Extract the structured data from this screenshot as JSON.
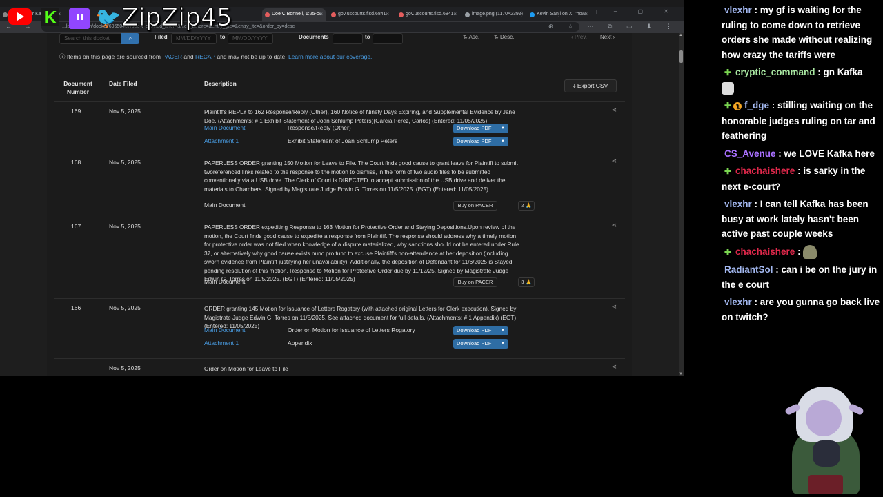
{
  "overlay": {
    "handle": "ZipZip45"
  },
  "browser": {
    "tabs": [
      {
        "label": "...'s Lawyer Kar",
        "active": false,
        "color": "#888888"
      },
      {
        "label": "Doe v. Bonnell, 1:25-cv",
        "active": true,
        "color": "#e35d5d"
      },
      {
        "label": "gov.uscourts.flsd.6841",
        "active": false,
        "color": "#e35d5d"
      },
      {
        "label": "gov.uscourts.flsd.6841",
        "active": false,
        "color": "#e35d5d"
      },
      {
        "label": "image.png (1170×2397)",
        "active": false,
        "color": "#9aa0a6"
      },
      {
        "label": "Kevin Sanji on X: \"how",
        "active": false,
        "color": "#1d9bf0"
      }
    ],
    "url": "...listener.com/docket/69650487/doe-v-b.../filed_after=&filed_before=&entry_gte=&entry_lte=&order_by=desc"
  },
  "filters": {
    "search_placeholder": "Search this docket",
    "filed_label": "Filed",
    "date_placeholder": "MM/DD/YYYY",
    "to_label": "to",
    "documents_label": "Documents",
    "asc": "Asc.",
    "desc": "Desc.",
    "prev": "Prev.",
    "next": "Next"
  },
  "notice": {
    "prefix": "Items on this page are sourced from",
    "pacer": "PACER",
    "and": "and",
    "recap": "RECAP",
    "suffix": "and may not be up to date.",
    "learn": "Learn more about our coverage."
  },
  "table": {
    "headers": {
      "doc_number": "Document Number",
      "date_filed": "Date Filed",
      "description": "Description"
    },
    "export": "Export CSV",
    "rows": [
      {
        "num": "169",
        "date": "Nov 5, 2025",
        "desc": "Plaintiff's REPLY to 162 Response/Reply (Other), 160 Notice of Ninety Days Expiring, and Supplemental Evidence by Jane Doe. (Attachments: # 1 Exhibit Statement of Joan Schlump Peters)(Garcia Perez, Carlos) (Entered: 11/05/2025)",
        "subs": [
          {
            "name": "Main Document",
            "desc": "Response/Reply (Other)",
            "action": "Download PDF"
          },
          {
            "name": "Attachment 1",
            "desc": "Exhibit Statement of Joan Schlump Peters",
            "action": "Download PDF"
          }
        ]
      },
      {
        "num": "168",
        "date": "Nov 5, 2025",
        "desc": "PAPERLESS ORDER granting 150 Motion for Leave to File. The Court finds good cause to grant leave for Plaintiff to submit tworeferenced links related to the response to the motion to dismiss, in the form of two audio files to be submitted conventionally via a USB drive. The Clerk of Court is DIRECTED to accept submission of the USB drive and deliver the materials to Chambers. Signed by Magistrate Judge Edwin G. Torres on 11/5/2025. (EGT) (Entered: 11/05/2025)",
        "subs": [
          {
            "name": "Main Document",
            "desc": "",
            "action": "Buy on PACER",
            "pray": "2 🙏"
          }
        ]
      },
      {
        "num": "167",
        "date": "Nov 5, 2025",
        "desc": "PAPERLESS ORDER expediting Response to 163 Motion for Protective Order and Staying Depositions.Upon review of the motion, the Court finds good cause to expedite a response from Plaintiff. The response should address why a timely motion for protective order was not filed when knowledge of a dispute materialized, why sanctions should not be entered under Rule 37, or alternatively why good cause exists nunc pro tunc to excuse Plaintiff's non-attendance at her deposition (including sworn evidence from Plaintiff justifying her unavailability). Additionally, the deposition of Defendant for 11/6/2025 is Stayed pending resolution of this motion. Response to Motion for Protective Order due by 11/12/25. Signed by Magistrate Judge Edwin G. Torres on 11/5/2025. (EGT) (Entered: 11/05/2025)",
        "subs": [
          {
            "name": "Main Document",
            "desc": "",
            "action": "Buy on PACER",
            "pray": "3 🙏"
          }
        ]
      },
      {
        "num": "166",
        "date": "Nov 5, 2025",
        "desc": "ORDER granting 145 Motion for Issuance of Letters Rogatory (with attached original Letters for Clerk execution). Signed by Magistrate Judge Edwin G. Torres on 11/5/2025. See attached document for full details. (Attachments: # 1 Appendix) (EGT) (Entered: 11/05/2025)",
        "subs": [
          {
            "name": "Main Document",
            "desc": "Order on Motion for Issuance of Letters Rogatory",
            "action": "Download PDF"
          },
          {
            "name": "Attachment 1",
            "desc": "Appendix",
            "action": "Download PDF"
          }
        ]
      },
      {
        "num": "",
        "date": "Nov 5, 2025",
        "desc": "Order on Motion for Leave to File",
        "subs": []
      }
    ]
  },
  "chat": [
    {
      "user": "vlexhr",
      "color": "#a3b8f0",
      "text": "my gf is waiting for the ruling to come down to retrieve orders she made without realizing how crazy the tariffs were",
      "badges": []
    },
    {
      "user": "cryptic_command",
      "color": "#a8e6a1",
      "text": "gn Kafka",
      "badges": [
        "sub"
      ],
      "emote": true
    },
    {
      "user": "f_dge",
      "color": "#a3b8f0",
      "text": "stilling waiting on the honorable judges ruling on tar and feathering",
      "badges": [
        "sub",
        "bits"
      ]
    },
    {
      "user": "CS_Avenue",
      "color": "#a970ff",
      "text": "we LOVE Kafka here",
      "badges": []
    },
    {
      "user": "chachaishere",
      "color": "#e0284b",
      "text": "is sarky in the next e-court?",
      "badges": [
        "sub"
      ]
    },
    {
      "user": "vlexhr",
      "color": "#a3b8f0",
      "text": "I can tell Kafka has been busy at work lately hasn't been active past couple weeks",
      "badges": []
    },
    {
      "user": "chachaishere",
      "color": "#e0284b",
      "text": "",
      "badges": [
        "sub"
      ],
      "emote2": true
    },
    {
      "user": "RadiantSol",
      "color": "#a3b8f0",
      "text": "can i be on the jury in the e court",
      "badges": []
    },
    {
      "user": "vlexhr",
      "color": "#a3b8f0",
      "text": "are you gunna go back live on twitch?",
      "badges": []
    }
  ]
}
